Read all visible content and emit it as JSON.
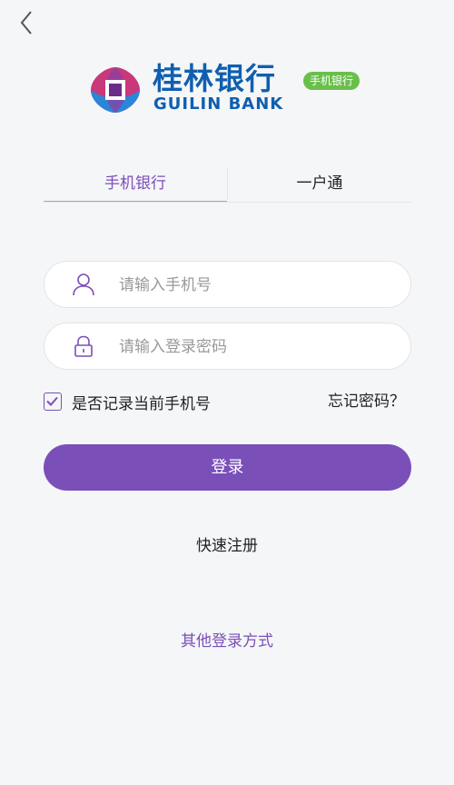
{
  "header": {
    "back_icon": "chevron-left-icon"
  },
  "brand": {
    "name_cn": "桂林银行",
    "name_en": "GUILIN BANK",
    "badge": "手机银行",
    "colors": {
      "primary": "#0f5fb0",
      "badge": "#6abf4b",
      "logo_pink": "#c8387a",
      "logo_blue": "#2a86d6"
    }
  },
  "tabs": [
    {
      "label": "手机银行",
      "active": true
    },
    {
      "label": "一户通",
      "active": false
    }
  ],
  "form": {
    "phone": {
      "placeholder": "请输入手机号",
      "value": "",
      "icon": "user-icon"
    },
    "password": {
      "placeholder": "请输入登录密码",
      "value": "",
      "icon": "lock-icon"
    },
    "remember": {
      "label": "是否记录当前手机号",
      "checked": true
    },
    "forgot_label": "忘记密码？",
    "submit_label": "登录"
  },
  "links": {
    "register": "快速注册",
    "other_login": "其他登录方式"
  },
  "theme": {
    "accent": "#7a4fb8",
    "background": "#f5f6f8"
  }
}
